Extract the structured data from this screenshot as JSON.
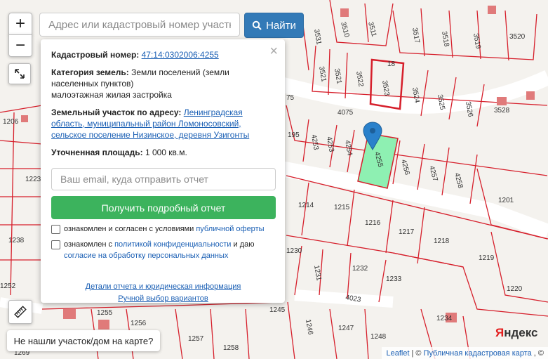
{
  "search": {
    "placeholder": "Адрес или кадастровый номер участка",
    "button_label": "Найти"
  },
  "zoom": {
    "in_label": "+",
    "out_label": "−"
  },
  "popup": {
    "cadastral_label": "Кадастровый номер:",
    "cadastral_value": "47:14:0302006:4255",
    "category_label": "Категория земель:",
    "category_value": "Земли поселений (земли населенных пунктов)",
    "use_value": "малоэтажная жилая застройка",
    "address_label": "Земельный участок по адресу:",
    "address_value": "Ленинградская область, муниципальный район Ломоносовский, сельское поселение Низинское, деревня Узигонты",
    "area_label": "Уточненная площадь:",
    "area_value": "1 000 кв.м.",
    "email_placeholder": "Ваш email, куда отправить отчет",
    "report_button": "Получить подробный отчет",
    "agree1_text": "ознакомлен и согласен с условиями",
    "agree1_link": "публичной оферты",
    "agree2_text": "ознакомлен с",
    "agree2_link": "политикой конфиденциальности",
    "agree2_text2": "и даю",
    "agree2_link2": "согласие на обработку персональных данных",
    "details_link": "Детали отчета и юридическая информация",
    "manual_link": "Ручной выбор вариантов",
    "close_glyph": "×"
  },
  "not_found_button": "Не нашли участок/дом на карте?",
  "attribution": {
    "leaflet": "Leaflet",
    "sep": "| ©",
    "pkk": "Публичная кадастровая карта",
    "tail": ", ©"
  },
  "yandex_logo": {
    "first": "Я",
    "rest": "ндекс"
  },
  "map": {
    "selected_parcel": "4255",
    "selected_color": "#8ef0b2",
    "boundary_color": "#d61f2b",
    "marker_color": "#2a81cb",
    "parcels": [
      "3510",
      "3511",
      "3517",
      "3518",
      "3519",
      "3520",
      "3531",
      "3521",
      "3521",
      "3522",
      "3523",
      "3524",
      "3525",
      "3526",
      "3528",
      "4075",
      "195",
      "4253",
      "4253",
      "4254",
      "4255",
      "4256",
      "4257",
      "4258",
      "1201",
      "1206",
      "1223",
      "1238",
      "1252",
      "1214",
      "1215",
      "1216",
      "1217",
      "1218",
      "1219",
      "1230",
      "1231",
      "1232",
      "1233",
      "1220",
      "1245",
      "1246",
      "1247",
      "1248",
      "1234",
      "1255",
      "1256",
      "1257",
      "1258",
      "1269",
      "4023",
      "75",
      "18"
    ]
  }
}
